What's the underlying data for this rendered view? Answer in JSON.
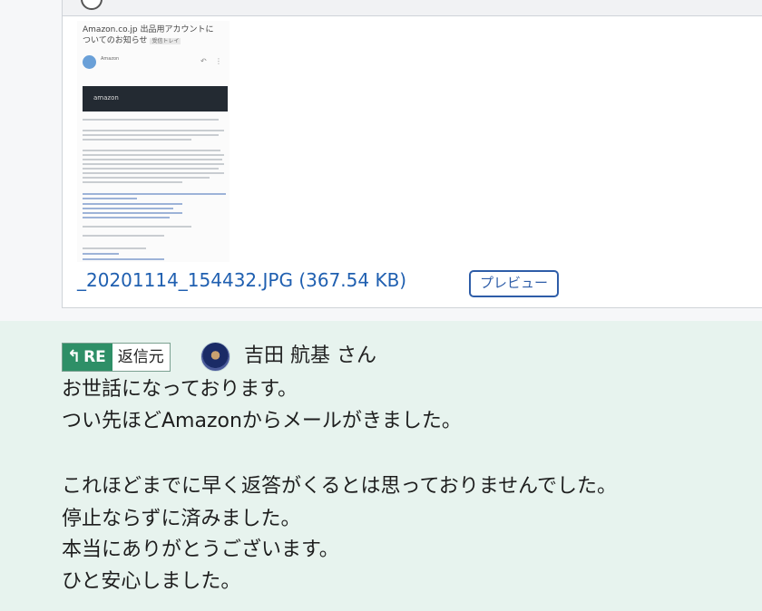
{
  "attachment": {
    "thumbnail_title": "Amazon.co.jp 出品用アカウントに ついてのお知らせ",
    "thumbnail_tag": "受信トレイ",
    "thumbnail_sender": "Amazon",
    "thumbnail_logo": "amazon",
    "file_name": "_20201114_154432.JPG (367.54 KB)",
    "preview_label": "プレビュー"
  },
  "reply": {
    "re_label": "RE",
    "reply_source_label": "返信元",
    "user_name": "吉田 航基 さん",
    "message_lines": [
      "お世話になっております。",
      "つい先ほどAmazonからメールがきました。",
      "",
      "これほどまでに早く返答がくるとは思っておりませんでした。",
      "停止ならずに済みました。",
      "本当にありがとうございます。",
      "ひと安心しました。"
    ]
  },
  "colors": {
    "accent_green": "#2e8f67",
    "reply_background": "#e7f3ee",
    "link_blue": "#1f5fb0"
  },
  "icons": {
    "reply_arrow": "reply-arrow-icon",
    "user_avatar": "user-avatar"
  }
}
